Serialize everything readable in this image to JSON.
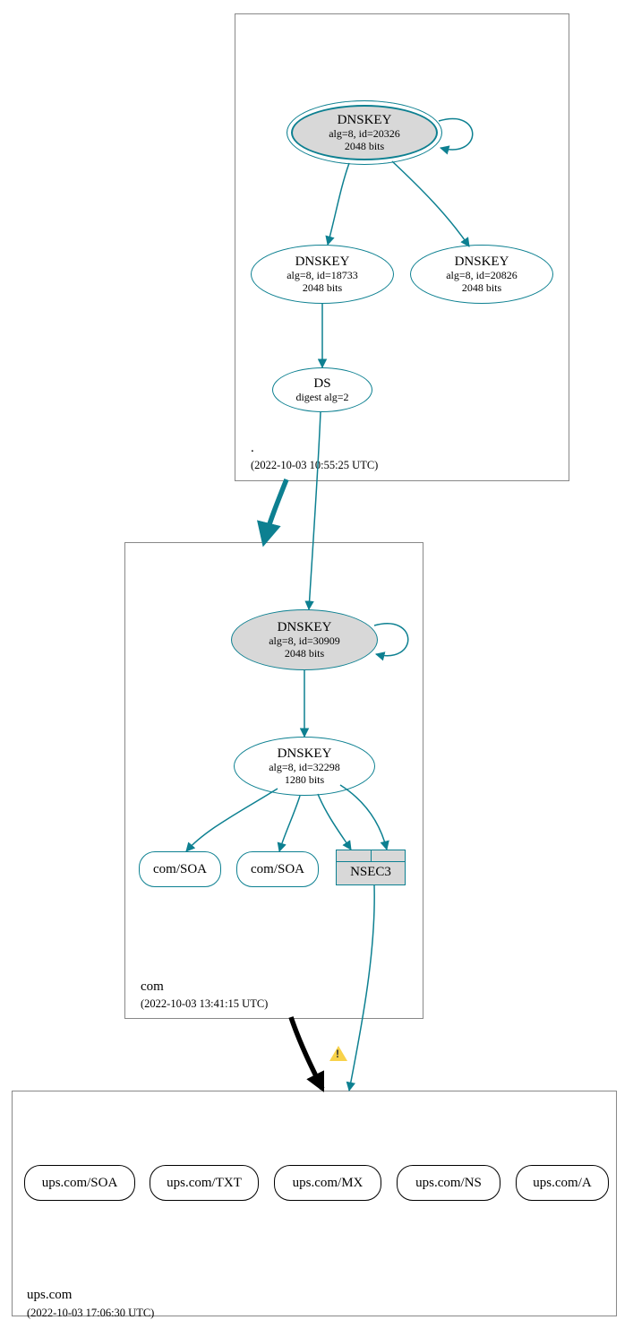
{
  "zones": {
    "root": {
      "label": ".",
      "timestamp": "(2022-10-03 10:55:25 UTC)",
      "nodes": {
        "ksk": {
          "title": "DNSKEY",
          "line1": "alg=8, id=20326",
          "line2": "2048 bits"
        },
        "zsk": {
          "title": "DNSKEY",
          "line1": "alg=8, id=18733",
          "line2": "2048 bits"
        },
        "k2": {
          "title": "DNSKEY",
          "line1": "alg=8, id=20826",
          "line2": "2048 bits"
        },
        "ds": {
          "title": "DS",
          "line1": "digest alg=2"
        }
      }
    },
    "com": {
      "label": "com",
      "timestamp": "(2022-10-03 13:41:15 UTC)",
      "nodes": {
        "ksk": {
          "title": "DNSKEY",
          "line1": "alg=8, id=30909",
          "line2": "2048 bits"
        },
        "zsk": {
          "title": "DNSKEY",
          "line1": "alg=8, id=32298",
          "line2": "1280 bits"
        },
        "soa1": {
          "label": "com/SOA"
        },
        "soa2": {
          "label": "com/SOA"
        },
        "nsec3": {
          "label": "NSEC3"
        }
      }
    },
    "ups": {
      "label": "ups.com",
      "timestamp": "(2022-10-03 17:06:30 UTC)",
      "nodes": {
        "soa": {
          "label": "ups.com/SOA"
        },
        "txt": {
          "label": "ups.com/TXT"
        },
        "mx": {
          "label": "ups.com/MX"
        },
        "ns": {
          "label": "ups.com/NS"
        },
        "a": {
          "label": "ups.com/A"
        }
      }
    }
  },
  "colors": {
    "teal": "#0d8091"
  }
}
